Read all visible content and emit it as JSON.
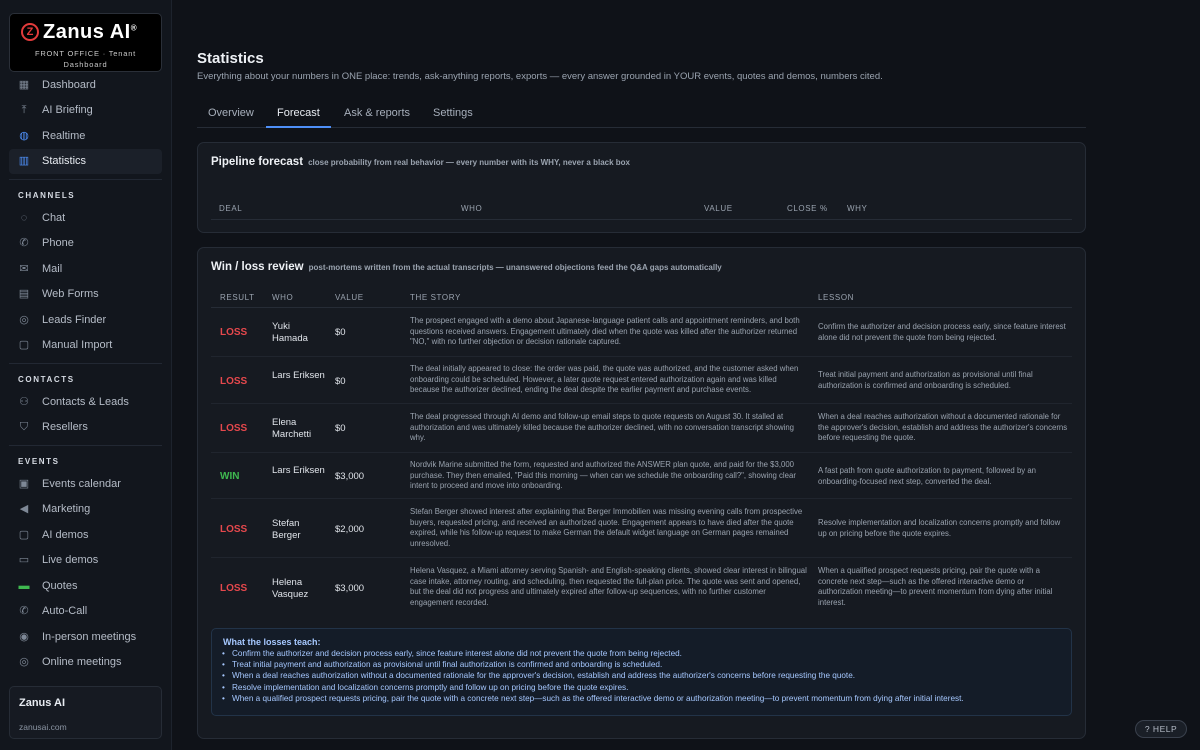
{
  "brand": {
    "logo_letter": "Z",
    "name": "Zanus AI",
    "reg": "®",
    "subtitle": "FRONT OFFICE · Tenant Dashboard"
  },
  "nav": {
    "main": [
      {
        "label": "Dashboard",
        "icon": "dashboard-icon",
        "glyph": "▦"
      },
      {
        "label": "AI Briefing",
        "icon": "upload-icon",
        "glyph": "⤒"
      },
      {
        "label": "Realtime",
        "icon": "globe-icon",
        "glyph": "◍"
      },
      {
        "label": "Statistics",
        "icon": "bar-chart-icon",
        "glyph": "▥"
      }
    ],
    "channels_title": "CHANNELS",
    "channels": [
      {
        "label": "Chat",
        "icon": "chat-icon",
        "glyph": "◌"
      },
      {
        "label": "Phone",
        "icon": "phone-icon",
        "glyph": "✆"
      },
      {
        "label": "Mail",
        "icon": "mail-icon",
        "glyph": "✉"
      },
      {
        "label": "Web Forms",
        "icon": "clipboard-icon",
        "glyph": "▤"
      },
      {
        "label": "Leads Finder",
        "icon": "radar-icon",
        "glyph": "◎"
      },
      {
        "label": "Manual Import",
        "icon": "file-import-icon",
        "glyph": "▢"
      }
    ],
    "contacts_title": "CONTACTS",
    "contacts": [
      {
        "label": "Contacts & Leads",
        "icon": "users-icon",
        "glyph": "⚇"
      },
      {
        "label": "Resellers",
        "icon": "handshake-icon",
        "glyph": "⛉"
      }
    ],
    "events_title": "EVENTS",
    "events": [
      {
        "label": "Events calendar",
        "icon": "calendar-icon",
        "glyph": "▣"
      },
      {
        "label": "Marketing",
        "icon": "megaphone-icon",
        "glyph": "◀"
      },
      {
        "label": "AI demos",
        "icon": "robot-icon",
        "glyph": "▢"
      },
      {
        "label": "Live demos",
        "icon": "screen-icon",
        "glyph": "▭"
      },
      {
        "label": "Quotes",
        "icon": "money-icon",
        "glyph": "▬"
      },
      {
        "label": "Auto-Call",
        "icon": "phone-forward-icon",
        "glyph": "✆"
      },
      {
        "label": "In-person meetings",
        "icon": "map-pin-icon",
        "glyph": "◉"
      },
      {
        "label": "Online meetings",
        "icon": "video-icon",
        "glyph": "◎"
      }
    ]
  },
  "tenant": {
    "name": "Zanus AI",
    "domain": "zanusai.com"
  },
  "page": {
    "title": "Statistics",
    "subtitle": "Everything about your numbers in ONE place: trends, ask-anything reports, exports — every answer grounded in YOUR events, quotes and demos, numbers cited."
  },
  "tabs": [
    "Overview",
    "Forecast",
    "Ask & reports",
    "Settings"
  ],
  "forecast": {
    "title": "Pipeline forecast",
    "desc": "close probability from real behavior — every number with its WHY, never a black box",
    "columns": {
      "deal": "DEAL",
      "who": "WHO",
      "value": "VALUE",
      "close": "CLOSE %",
      "why": "WHY"
    }
  },
  "winloss": {
    "title": "Win / loss review",
    "desc": "post-mortems written from the actual transcripts — unanswered objections feed the Q&A gaps automatically",
    "columns": {
      "result": "RESULT",
      "who": "WHO",
      "value": "VALUE",
      "story": "THE STORY",
      "lesson": "LESSON"
    },
    "rows": [
      {
        "result": "LOSS",
        "who": "Yuki Hamada",
        "value": "$0",
        "story": "The prospect engaged with a demo about Japanese-language patient calls and appointment reminders, and both questions received answers. Engagement ultimately died when the quote was killed after the authorizer returned \"NO,\" with no further objection or decision rationale captured.",
        "lesson": "Confirm the authorizer and decision process early, since feature interest alone did not prevent the quote from being rejected."
      },
      {
        "result": "LOSS",
        "who": "Lars Eriksen",
        "value": "$0",
        "story": "The deal initially appeared to close: the order was paid, the quote was authorized, and the customer asked when onboarding could be scheduled. However, a later quote request entered authorization again and was killed because the authorizer declined, ending the deal despite the earlier payment and purchase events.",
        "lesson": "Treat initial payment and authorization as provisional until final authorization is confirmed and onboarding is scheduled."
      },
      {
        "result": "LOSS",
        "who": "Elena Marchetti",
        "value": "$0",
        "story": "The deal progressed through AI demo and follow-up email steps to quote requests on August 30. It stalled at authorization and was ultimately killed because the authorizer declined, with no conversation transcript showing why.",
        "lesson": "When a deal reaches authorization without a documented rationale for the approver's decision, establish and address the authorizer's concerns before requesting the quote."
      },
      {
        "result": "WIN",
        "who": "Lars Eriksen",
        "value": "$3,000",
        "story": "Nordvik Marine submitted the form, requested and authorized the ANSWER plan quote, and paid for the $3,000 purchase. They then emailed, \"Paid this morning — when can we schedule the onboarding call?\", showing clear intent to proceed and move into onboarding.",
        "lesson": "A fast path from quote authorization to payment, followed by an onboarding-focused next step, converted the deal."
      },
      {
        "result": "LOSS",
        "who": "Stefan Berger",
        "value": "$2,000",
        "story": "Stefan Berger showed interest after explaining that Berger Immobilien was missing evening calls from prospective buyers, requested pricing, and received an authorized quote. Engagement appears to have died after the quote expired, while his follow-up request to make German the default widget language on German pages remained unresolved.",
        "lesson": "Resolve implementation and localization concerns promptly and follow up on pricing before the quote expires."
      },
      {
        "result": "LOSS",
        "who": "Helena Vasquez",
        "value": "$3,000",
        "story": "Helena Vasquez, a Miami attorney serving Spanish- and English-speaking clients, showed clear interest in bilingual case intake, attorney routing, and scheduling, then requested the full-plan price. The quote was sent and opened, but the deal did not progress and ultimately expired after follow-up sequences, with no further customer engagement recorded.",
        "lesson": "When a qualified prospect requests pricing, pair the quote with a concrete next step—such as the offered interactive demo or authorization meeting—to prevent momentum from dying after initial interest."
      }
    ],
    "teach_title": "What the losses teach:",
    "teach": [
      "Confirm the authorizer and decision process early, since feature interest alone did not prevent the quote from being rejected.",
      "Treat initial payment and authorization as provisional until final authorization is confirmed and onboarding is scheduled.",
      "When a deal reaches authorization without a documented rationale for the approver's decision, establish and address the authorizer's concerns before requesting the quote.",
      "Resolve implementation and localization concerns promptly and follow up on pricing before the quote expires.",
      "When a qualified prospect requests pricing, pair the quote with a concrete next step—such as the offered interactive demo or authorization meeting—to prevent momentum from dying after initial interest."
    ]
  },
  "help": "? HELP"
}
